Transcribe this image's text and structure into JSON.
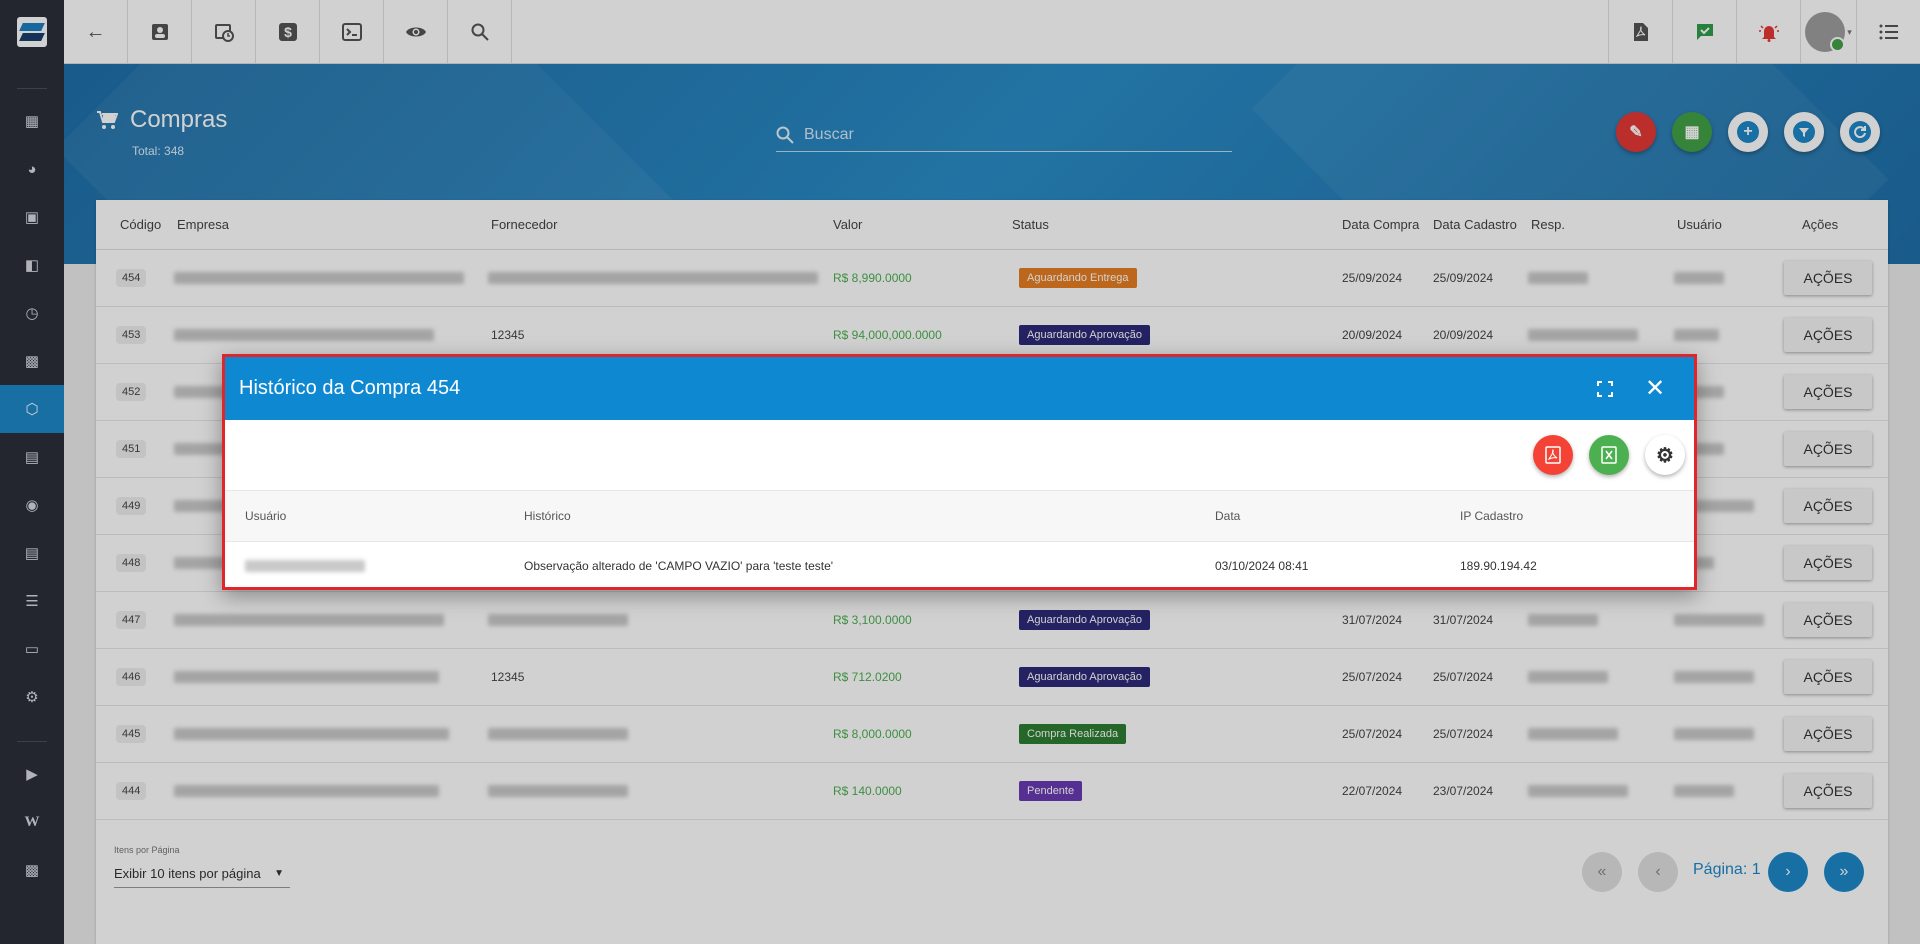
{
  "topbar": {
    "left_icons": [
      "back-arrow-icon",
      "contact-card-icon",
      "calendar-clock-icon",
      "dollar-icon",
      "terminal-icon",
      "eye-icon",
      "search-icon"
    ],
    "right_icons": [
      "pdf-file-icon",
      "chat-check-icon",
      "alarm-bell-icon"
    ]
  },
  "sidebar": {
    "items": [
      "dashboard-icon",
      "pie-chart-icon",
      "contact-icon",
      "board-icon",
      "calendar-icon",
      "building-icon",
      "box-icon",
      "money-icon",
      "location-icon",
      "list-icon",
      "layers-icon",
      "document-icon",
      "gear-icon",
      "video-icon",
      "wiki-icon",
      "chat-icon"
    ],
    "active_index": 6
  },
  "header": {
    "title": "Compras",
    "total": "Total: 348",
    "search_placeholder": "Buscar"
  },
  "table": {
    "columns": {
      "codigo": "Código",
      "empresa": "Empresa",
      "fornecedor": "Fornecedor",
      "valor": "Valor",
      "status": "Status",
      "data_compra": "Data Compra",
      "data_cadastro": "Data Cadastro",
      "resp": "Resp.",
      "usuario": "Usuário",
      "acoes": "Ações"
    },
    "rows": [
      {
        "codigo": "454",
        "fornecedor": "",
        "valor": "R$ 8,990.0000",
        "status": "Aguardando Entrega",
        "status_color": "#e67e22",
        "data_compra": "25/09/2024",
        "data_cadastro": "25/09/2024",
        "acao": "AÇÕES"
      },
      {
        "codigo": "453",
        "fornecedor": "12345",
        "valor": "R$ 94,000,000.0000",
        "status": "Aguardando Aprovação",
        "status_color": "#2c2a78",
        "data_compra": "20/09/2024",
        "data_cadastro": "20/09/2024",
        "acao": "AÇÕES"
      },
      {
        "codigo": "452",
        "fornecedor": "",
        "valor": "",
        "status": "",
        "status_color": "",
        "data_compra": "",
        "data_cadastro": "",
        "acao": "AÇÕES"
      },
      {
        "codigo": "451",
        "fornecedor": "",
        "valor": "",
        "status": "",
        "status_color": "",
        "data_compra": "",
        "data_cadastro": "",
        "acao": "AÇÕES"
      },
      {
        "codigo": "449",
        "fornecedor": "",
        "valor": "",
        "status": "",
        "status_color": "",
        "data_compra": "",
        "data_cadastro": "",
        "acao": "AÇÕES"
      },
      {
        "codigo": "448",
        "fornecedor": "",
        "valor": "",
        "status": "",
        "status_color": "",
        "data_compra": "",
        "data_cadastro": "",
        "acao": "AÇÕES"
      },
      {
        "codigo": "447",
        "fornecedor": "",
        "valor": "R$ 3,100.0000",
        "status": "Aguardando Aprovação",
        "status_color": "#2c2a78",
        "data_compra": "31/07/2024",
        "data_cadastro": "31/07/2024",
        "acao": "AÇÕES"
      },
      {
        "codigo": "446",
        "fornecedor": "12345",
        "valor": "R$ 712.0200",
        "status": "Aguardando Aprovação",
        "status_color": "#2c2a78",
        "data_compra": "25/07/2024",
        "data_cadastro": "25/07/2024",
        "acao": "AÇÕES"
      },
      {
        "codigo": "445",
        "fornecedor": "",
        "valor": "R$ 8,000.0000",
        "status": "Compra Realizada",
        "status_color": "#2e7d32",
        "data_compra": "25/07/2024",
        "data_cadastro": "25/07/2024",
        "acao": "AÇÕES"
      },
      {
        "codigo": "444",
        "fornecedor": "",
        "valor": "R$ 140.0000",
        "status": "Pendente",
        "status_color": "#6a3ab2",
        "data_compra": "22/07/2024",
        "data_cadastro": "23/07/2024",
        "acao": "AÇÕES"
      }
    ]
  },
  "pagination": {
    "items_label": "Itens por Página",
    "items_value": "Exibir 10 itens por página",
    "page_label": "Página: 1"
  },
  "modal": {
    "title": "Histórico da Compra 454",
    "columns": {
      "usuario": "Usuário",
      "historico": "Histórico",
      "data": "Data",
      "ip": "IP Cadastro"
    },
    "rows": [
      {
        "historico": "Observação alterado de 'CAMPO VAZIO' para 'teste teste'",
        "data": "03/10/2024 08:41",
        "ip": "189.90.194.42"
      }
    ]
  },
  "colors": {
    "primary": "#1e88c9",
    "header_blue": "#0f88d2",
    "pdf_red": "#e53935",
    "excel_green": "#43a047",
    "modal_border": "#e0252b"
  }
}
